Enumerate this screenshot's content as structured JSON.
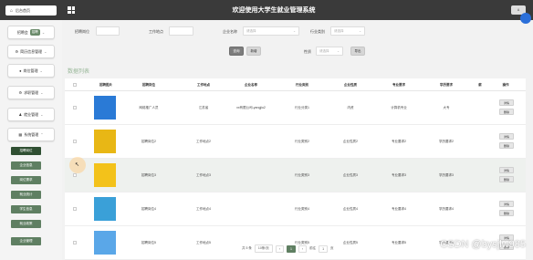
{
  "header": {
    "home_label": "后台首页",
    "home_icon": "home-icon",
    "title": "欢迎使用大学生就业管理系统",
    "user_label": "A"
  },
  "sidebar": {
    "groups": [
      {
        "label": "招聘会",
        "tag": "招聘"
      },
      {
        "label": "简历信息管理",
        "tag": ""
      },
      {
        "label": "岗位管理",
        "tag": ""
      },
      {
        "label": "求职管理",
        "tag": ""
      },
      {
        "label": "就业管理",
        "tag": ""
      },
      {
        "label": "系统管理",
        "tag": ""
      }
    ],
    "sub_items": [
      "招聘岗位",
      "企业信息",
      "岗位需求",
      "就业统计",
      "学生信息",
      "就业政策",
      "企业管理"
    ]
  },
  "filters": {
    "fields": [
      {
        "label": "招聘岗位",
        "placeholder": "",
        "kind": "input"
      },
      {
        "label": "工作地点",
        "placeholder": "",
        "kind": "input"
      },
      {
        "label": "企业名称",
        "placeholder": "请选择",
        "kind": "select"
      },
      {
        "label": "行业类别",
        "placeholder": "请选择",
        "kind": "select"
      },
      {
        "label": "性质",
        "placeholder": "请选择",
        "kind": "select"
      }
    ],
    "buttons": [
      "查询",
      "新增",
      "导出",
      "批量"
    ]
  },
  "table": {
    "section_title": "数据列表",
    "columns": [
      "招聘图片",
      "招聘岗位",
      "工作地点",
      "企业名称",
      "行业类别",
      "企业性质",
      "专业要求",
      "学历要求",
      "薪",
      "操作"
    ],
    "rows": [
      {
        "thumb_color": "#2a7ad6",
        "cells": [
          "网络推广人员",
          "江苏省",
          "xx有限公司-yangjiu2",
          "行业分类1",
          "内资",
          "计算机专业",
          "大专"
        ],
        "actions": [
          "详情",
          "删除"
        ]
      },
      {
        "thumb_color": "#e8b715",
        "cells": [
          "招聘岗位2",
          "工作地点2",
          "",
          "行业类别2",
          "企业性质2",
          "专业要求2",
          "学历要求2"
        ],
        "actions": [
          "详情",
          "删除"
        ]
      },
      {
        "thumb_color": "#f3c21a",
        "cells": [
          "招聘岗位3",
          "工作地点3",
          "",
          "行业类别3",
          "企业性质3",
          "专业要求3",
          "学历要求3"
        ],
        "actions": [
          "详情",
          "删除"
        ]
      },
      {
        "thumb_color": "#3aa0d8",
        "cells": [
          "招聘岗位4",
          "工作地点4",
          "",
          "行业类别4",
          "企业性质4",
          "专业要求4",
          "学历要求4"
        ],
        "actions": [
          "详情",
          "删除"
        ]
      },
      {
        "thumb_color": "#5aa7e8",
        "cells": [
          "招聘岗位5",
          "工作地点5",
          "",
          "行业类别5",
          "企业性质5",
          "专业要求5",
          "学历要求5"
        ],
        "actions": [
          "详情",
          "删除"
        ]
      }
    ]
  },
  "pagination": {
    "total": "共 5 条",
    "page_size": "10条/页",
    "prev": "‹",
    "page": "1",
    "next": "›",
    "goto_label": "前往",
    "goto_value": "1",
    "suffix": "页"
  },
  "watermark": "CSDN @bysjlw985",
  "colors": {
    "topbar": "#3a3a3a",
    "accent": "#5f7f62",
    "accent_dark": "#2f4f32"
  }
}
